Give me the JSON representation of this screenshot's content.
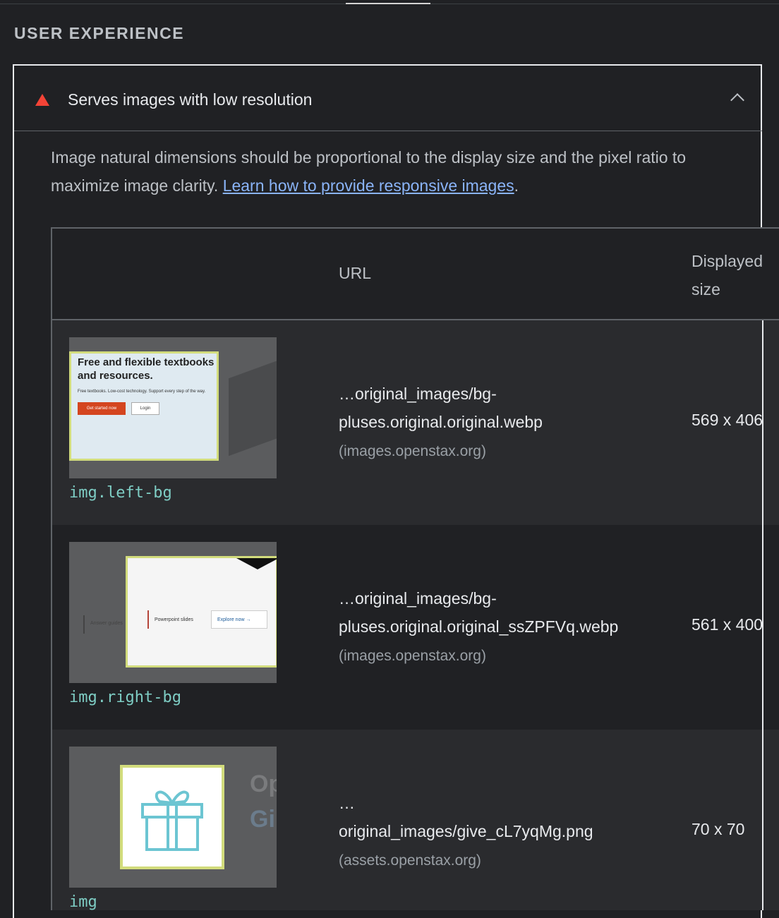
{
  "section": {
    "title": "USER EXPERIENCE"
  },
  "audit": {
    "title": "Serves images with low resolution",
    "status": "fail",
    "description": "Image natural dimensions should be proportional to the display size and the pixel ratio to maximize image clarity. ",
    "link_text": "Learn how to provide responsive images",
    "description_end": "."
  },
  "table": {
    "headers": {
      "url": "URL",
      "size": "Displayed size"
    },
    "rows": [
      {
        "node": "img.left-bg",
        "url_line1": "…original_images/bg-",
        "url_line2": "pluses.original.original.webp",
        "origin": "(images.openstax.org)",
        "size": "569 x 406",
        "thumb": {
          "heading": "Free and flexible textbooks and resources.",
          "sub": "Free textbooks. Low-cost technology. Support every step of the way.",
          "primary": "Get started now",
          "secondary": "Login"
        }
      },
      {
        "node": "img.right-bg",
        "url_line1": "…original_images/bg-",
        "url_line2": "pluses.original.original_ssZPFVq.webp",
        "origin": "(images.openstax.org)",
        "size": "561 x 400",
        "thumb": {
          "left_label": "Answer guides",
          "mid_label": "Powerpoint slides",
          "button": "Explore now →"
        }
      },
      {
        "node": "img",
        "url_line1": "…",
        "url_line2": "original_images/give_cL7yqMg.png",
        "origin": "(assets.openstax.org)",
        "size": "70 x 70",
        "thumb": {
          "big1": "Op",
          "big2": "Gi",
          "icon": "gift-icon"
        }
      }
    ]
  },
  "colors": {
    "fail": "#f44336",
    "link": "#8ab4f8",
    "node": "#7ecdc4",
    "highlight": "#d2dc7c"
  }
}
